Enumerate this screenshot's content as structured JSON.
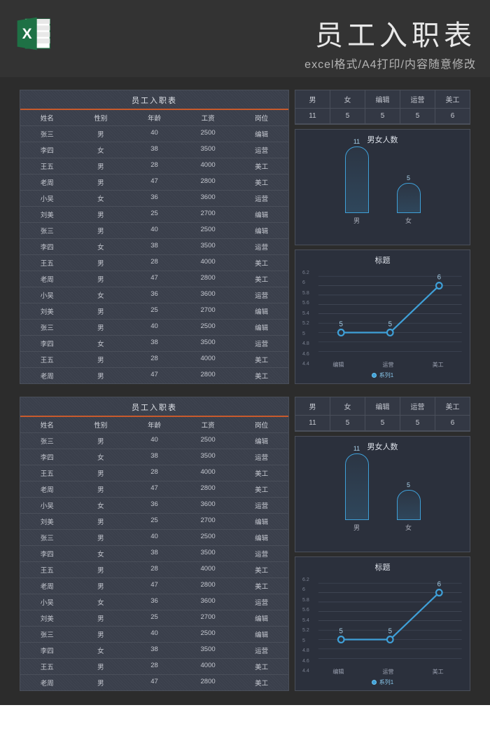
{
  "header": {
    "title": "员工入职表",
    "subtitle": "excel格式/A4打印/内容随意修改"
  },
  "table": {
    "title": "员工入职表",
    "columns": [
      "姓名",
      "性别",
      "年龄",
      "工资",
      "岗位"
    ],
    "rows": [
      [
        "张三",
        "男",
        "40",
        "2500",
        "编辑"
      ],
      [
        "李四",
        "女",
        "38",
        "3500",
        "运营"
      ],
      [
        "王五",
        "男",
        "28",
        "4000",
        "美工"
      ],
      [
        "老周",
        "男",
        "47",
        "2800",
        "美工"
      ],
      [
        "小吴",
        "女",
        "36",
        "3600",
        "运营"
      ],
      [
        "刘美",
        "男",
        "25",
        "2700",
        "编辑"
      ],
      [
        "张三",
        "男",
        "40",
        "2500",
        "编辑"
      ],
      [
        "李四",
        "女",
        "38",
        "3500",
        "运营"
      ],
      [
        "王五",
        "男",
        "28",
        "4000",
        "美工"
      ],
      [
        "老周",
        "男",
        "47",
        "2800",
        "美工"
      ],
      [
        "小吴",
        "女",
        "36",
        "3600",
        "运营"
      ],
      [
        "刘美",
        "男",
        "25",
        "2700",
        "编辑"
      ],
      [
        "张三",
        "男",
        "40",
        "2500",
        "编辑"
      ],
      [
        "李四",
        "女",
        "38",
        "3500",
        "运营"
      ],
      [
        "王五",
        "男",
        "28",
        "4000",
        "美工"
      ],
      [
        "老周",
        "男",
        "47",
        "2800",
        "美工"
      ]
    ]
  },
  "summary": {
    "headers": [
      "男",
      "女",
      "编辑",
      "运营",
      "美工"
    ],
    "values": [
      "11",
      "5",
      "5",
      "5",
      "6"
    ]
  },
  "chart_data": [
    {
      "type": "bar",
      "title": "男女人数",
      "categories": [
        "男",
        "女"
      ],
      "values": [
        11,
        5
      ],
      "ylim": [
        0,
        12
      ]
    },
    {
      "type": "line",
      "title": "标题",
      "categories": [
        "编辑",
        "运营",
        "美工"
      ],
      "series": [
        {
          "name": "系列1",
          "values": [
            5,
            5,
            6
          ]
        }
      ],
      "ylim": [
        4.4,
        6.2
      ],
      "yticks": [
        4.4,
        4.6,
        4.8,
        5,
        5.2,
        5.4,
        5.6,
        5.8,
        6,
        6.2
      ]
    }
  ],
  "icons": {
    "excel_letter": "X"
  }
}
